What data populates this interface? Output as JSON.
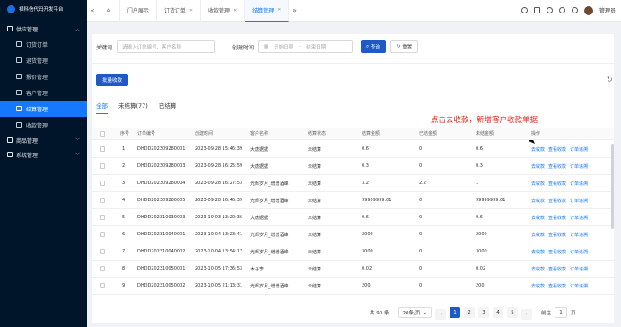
{
  "app": {
    "title": "禄科信代码开发平台"
  },
  "sidebar": {
    "group_supply": "供应管理",
    "items": [
      {
        "label": "订货订单",
        "icon": "file-icon"
      },
      {
        "label": "退货管理",
        "icon": "file-icon"
      },
      {
        "label": "报价管理",
        "icon": "quote-icon"
      },
      {
        "label": "客户管理",
        "icon": "user-icon"
      },
      {
        "label": "结算管理",
        "icon": "settle-icon"
      },
      {
        "label": "收款管理",
        "icon": "money-icon"
      }
    ],
    "group_goods": "商品管理",
    "group_system": "系统管理"
  },
  "tabs": [
    {
      "label": "门户展示",
      "closable": false
    },
    {
      "label": "订货订单",
      "closable": true
    },
    {
      "label": "收款管理",
      "closable": true
    },
    {
      "label": "结算管理",
      "closable": true,
      "active": true
    }
  ],
  "user": {
    "name": "管理员"
  },
  "filter": {
    "keyword_label": "关键词",
    "keyword_placeholder": "请输入订单编号、客户名称",
    "time_label": "创建时间",
    "start_placeholder": "开始日期",
    "range_sep": "-",
    "end_placeholder": "结束日期",
    "search": "查询",
    "reset": "重置"
  },
  "batch_button": "批量收款",
  "subtabs": [
    "全部",
    "未结算(77)",
    "已结算"
  ],
  "annotation": "点击去收款，新增客户收款单据",
  "table": {
    "headers": [
      "序号",
      "订单编号",
      "创建时间",
      "客户名称",
      "结算状态",
      "结算金额",
      "已结金额",
      "未结金额",
      "操作"
    ],
    "rows": [
      [
        "1",
        "DHDD202309280001",
        "2023-09-28 15:46:39",
        "大唐据据",
        "未结算",
        "0.6",
        "0",
        "0.6"
      ],
      [
        "2",
        "DHDD202309280003",
        "2023-09-28 16:25:59",
        "大唐据据",
        "未结算",
        "0.3",
        "0",
        "0.3"
      ],
      [
        "3",
        "DHDD202309280004",
        "2023-09-28 16:27:53",
        "光辉岁月_增增酒峰",
        "未结算",
        "3.2",
        "2.2",
        "1"
      ],
      [
        "4",
        "DHDD202309280005",
        "2023-09-28 16:46:39",
        "光辉岁月_增增酒峰",
        "未结算",
        "99999999.01",
        "0",
        "99999999.01"
      ],
      [
        "5",
        "DHDD202310030003",
        "2023-10-03 13:20:36",
        "大唐据据",
        "未结算",
        "0.6",
        "0",
        "0.6"
      ],
      [
        "6",
        "DHDD202310040001",
        "2023-10-04 13:23:41",
        "光辉岁月_增增酒峰",
        "未结算",
        "2000",
        "0",
        "2000"
      ],
      [
        "7",
        "DHDD202310040002",
        "2023-10-04 13:54:17",
        "光辉岁月_增增酒峰",
        "未结算",
        "3000",
        "0",
        "3000"
      ],
      [
        "8",
        "DHDD202310050001",
        "2023-10-05 17:36:53",
        "木子李",
        "未结算",
        "0.02",
        "0",
        "0.02"
      ],
      [
        "9",
        "DHDD202310050002",
        "2023-10-05 21:13:31",
        "光辉岁月_增增酒峰",
        "未结算",
        "200",
        "0",
        "200"
      ]
    ],
    "actions": [
      "去收款",
      "查看收款",
      "订单追溯"
    ]
  },
  "pagination": {
    "total": "共 90 条",
    "page_size": "20条/页",
    "pages": [
      "1",
      "2",
      "3",
      "4",
      "5"
    ],
    "current": "1",
    "goto_label": "前往",
    "goto_value": "1",
    "page_unit": "页"
  },
  "colors": {
    "primary": "#1f58c7",
    "sidebar_bg": "#001529",
    "annotation": "#e1251b"
  }
}
